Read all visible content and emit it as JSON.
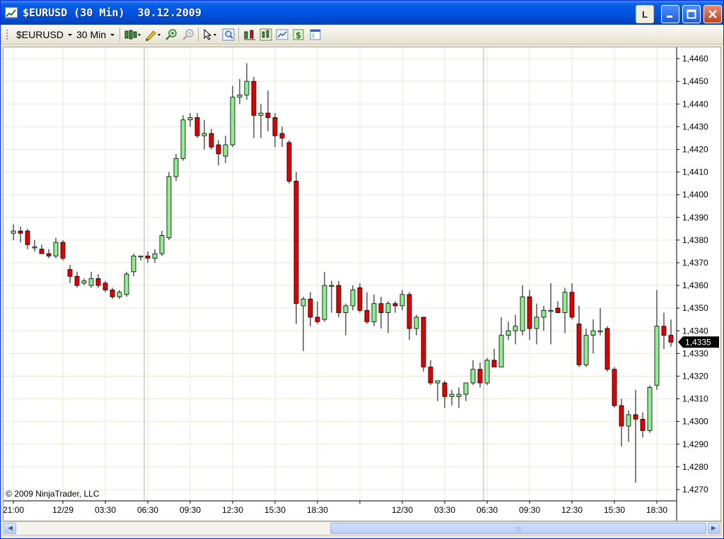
{
  "window": {
    "title": "$EURUSD (30 Min)  30.12.2009",
    "l_button": "L"
  },
  "toolbar": {
    "instrument": "$EURUSD",
    "interval": "30 Min",
    "icons": [
      "chart-style-icon",
      "drawing-pencil-icon",
      "zoom-in-icon",
      "zoom-out-icon",
      "cursor-icon",
      "magnifier-icon",
      "bar-spacing-icon",
      "indicators-icon",
      "strategies-icon",
      "dollar-icon",
      "properties-icon"
    ]
  },
  "chart": {
    "copyright": "© 2009 NinjaTrader, LLC",
    "last_price_label": "1,4335",
    "colors": {
      "up": "#90ee90",
      "down": "#e00000",
      "wick": "#000000",
      "grid": "#ebe8d8",
      "marker_bg": "#000000"
    }
  },
  "chart_data": {
    "type": "candlestick",
    "ylim": [
      1.4265,
      1.4465
    ],
    "y_ticks": [
      "1,4460",
      "1,4450",
      "1,4440",
      "1,4430",
      "1,4420",
      "1,4410",
      "1,4400",
      "1,4390",
      "1,4380",
      "1,4370",
      "1,4360",
      "1,4350",
      "1,4340",
      "1,4330",
      "1,4320",
      "1,4310",
      "1,4300",
      "1,4290",
      "1,4280",
      "1,4270"
    ],
    "x_ticks": [
      {
        "i": 0,
        "label": "21:00"
      },
      {
        "i": 7,
        "label": "12/29"
      },
      {
        "i": 13,
        "label": "03:30"
      },
      {
        "i": 19,
        "label": "06:30"
      },
      {
        "i": 25,
        "label": "09:30"
      },
      {
        "i": 31,
        "label": "12:30"
      },
      {
        "i": 37,
        "label": "15:30"
      },
      {
        "i": 43,
        "label": "18:30"
      },
      {
        "i": 49,
        "label": ""
      },
      {
        "i": 55,
        "label": "12/30"
      },
      {
        "i": 61,
        "label": "03:30"
      },
      {
        "i": 67,
        "label": "06:30"
      },
      {
        "i": 73,
        "label": "09:30"
      },
      {
        "i": 79,
        "label": "12:30"
      },
      {
        "i": 85,
        "label": "15:30"
      },
      {
        "i": 91,
        "label": "18:30"
      }
    ],
    "day_separators": [
      19,
      67
    ],
    "candles": [
      {
        "o": 1.4383,
        "h": 1.4387,
        "l": 1.438,
        "c": 1.4384
      },
      {
        "o": 1.4384,
        "h": 1.4386,
        "l": 1.4379,
        "c": 1.4383
      },
      {
        "o": 1.4384,
        "h": 1.4385,
        "l": 1.4376,
        "c": 1.4378
      },
      {
        "o": 1.4377,
        "h": 1.438,
        "l": 1.4375,
        "c": 1.4377
      },
      {
        "o": 1.4376,
        "h": 1.4378,
        "l": 1.4374,
        "c": 1.4374
      },
      {
        "o": 1.4374,
        "h": 1.4376,
        "l": 1.4372,
        "c": 1.4373
      },
      {
        "o": 1.4373,
        "h": 1.4381,
        "l": 1.4372,
        "c": 1.4379
      },
      {
        "o": 1.4379,
        "h": 1.438,
        "l": 1.4371,
        "c": 1.4372
      },
      {
        "o": 1.4367,
        "h": 1.4369,
        "l": 1.4361,
        "c": 1.4364
      },
      {
        "o": 1.4364,
        "h": 1.4366,
        "l": 1.4359,
        "c": 1.436
      },
      {
        "o": 1.4361,
        "h": 1.4363,
        "l": 1.436,
        "c": 1.4362
      },
      {
        "o": 1.436,
        "h": 1.4366,
        "l": 1.4359,
        "c": 1.4363
      },
      {
        "o": 1.4363,
        "h": 1.4365,
        "l": 1.4359,
        "c": 1.436
      },
      {
        "o": 1.4361,
        "h": 1.4362,
        "l": 1.4357,
        "c": 1.4358
      },
      {
        "o": 1.4358,
        "h": 1.4359,
        "l": 1.4354,
        "c": 1.4355
      },
      {
        "o": 1.4355,
        "h": 1.4358,
        "l": 1.4354,
        "c": 1.4357
      },
      {
        "o": 1.4356,
        "h": 1.4366,
        "l": 1.4355,
        "c": 1.4365
      },
      {
        "o": 1.4366,
        "h": 1.4374,
        "l": 1.4364,
        "c": 1.4373
      },
      {
        "o": 1.4373,
        "h": 1.4373,
        "l": 1.4371,
        "c": 1.4373
      },
      {
        "o": 1.4373,
        "h": 1.4375,
        "l": 1.437,
        "c": 1.4372
      },
      {
        "o": 1.4372,
        "h": 1.4376,
        "l": 1.437,
        "c": 1.4374
      },
      {
        "o": 1.4374,
        "h": 1.4384,
        "l": 1.4373,
        "c": 1.4382
      },
      {
        "o": 1.4381,
        "h": 1.441,
        "l": 1.438,
        "c": 1.4408
      },
      {
        "o": 1.4408,
        "h": 1.4418,
        "l": 1.4406,
        "c": 1.4416
      },
      {
        "o": 1.4416,
        "h": 1.4435,
        "l": 1.4415,
        "c": 1.4433
      },
      {
        "o": 1.4433,
        "h": 1.4436,
        "l": 1.443,
        "c": 1.4434
      },
      {
        "o": 1.4434,
        "h": 1.4436,
        "l": 1.4425,
        "c": 1.4426
      },
      {
        "o": 1.4426,
        "h": 1.4433,
        "l": 1.442,
        "c": 1.4427
      },
      {
        "o": 1.4427,
        "h": 1.4429,
        "l": 1.442,
        "c": 1.4421
      },
      {
        "o": 1.4422,
        "h": 1.4424,
        "l": 1.4413,
        "c": 1.4418
      },
      {
        "o": 1.4417,
        "h": 1.4426,
        "l": 1.4414,
        "c": 1.4422
      },
      {
        "o": 1.4422,
        "h": 1.4448,
        "l": 1.4421,
        "c": 1.4443
      },
      {
        "o": 1.4443,
        "h": 1.4451,
        "l": 1.444,
        "c": 1.4444
      },
      {
        "o": 1.4444,
        "h": 1.4458,
        "l": 1.4442,
        "c": 1.445
      },
      {
        "o": 1.445,
        "h": 1.4452,
        "l": 1.4425,
        "c": 1.4435
      },
      {
        "o": 1.4435,
        "h": 1.444,
        "l": 1.4425,
        "c": 1.4436
      },
      {
        "o": 1.4436,
        "h": 1.4446,
        "l": 1.4428,
        "c": 1.4434
      },
      {
        "o": 1.4434,
        "h": 1.4436,
        "l": 1.4421,
        "c": 1.4426
      },
      {
        "o": 1.4427,
        "h": 1.443,
        "l": 1.4421,
        "c": 1.4425
      },
      {
        "o": 1.4423,
        "h": 1.4424,
        "l": 1.4405,
        "c": 1.4406
      },
      {
        "o": 1.4406,
        "h": 1.441,
        "l": 1.4343,
        "c": 1.4352
      },
      {
        "o": 1.4351,
        "h": 1.4355,
        "l": 1.4331,
        "c": 1.4354
      },
      {
        "o": 1.4354,
        "h": 1.4357,
        "l": 1.4342,
        "c": 1.4346
      },
      {
        "o": 1.4346,
        "h": 1.4353,
        "l": 1.4343,
        "c": 1.4344
      },
      {
        "o": 1.4345,
        "h": 1.4366,
        "l": 1.4344,
        "c": 1.436
      },
      {
        "o": 1.436,
        "h": 1.4362,
        "l": 1.4348,
        "c": 1.436
      },
      {
        "o": 1.436,
        "h": 1.4362,
        "l": 1.4346,
        "c": 1.4348
      },
      {
        "o": 1.4348,
        "h": 1.4352,
        "l": 1.4338,
        "c": 1.4351
      },
      {
        "o": 1.4351,
        "h": 1.436,
        "l": 1.4349,
        "c": 1.4358
      },
      {
        "o": 1.4359,
        "h": 1.4361,
        "l": 1.4348,
        "c": 1.4349
      },
      {
        "o": 1.4349,
        "h": 1.4357,
        "l": 1.4343,
        "c": 1.4344
      },
      {
        "o": 1.4344,
        "h": 1.4356,
        "l": 1.4342,
        "c": 1.4352
      },
      {
        "o": 1.4352,
        "h": 1.4355,
        "l": 1.4341,
        "c": 1.4348
      },
      {
        "o": 1.4348,
        "h": 1.4353,
        "l": 1.4339,
        "c": 1.4352
      },
      {
        "o": 1.4352,
        "h": 1.4353,
        "l": 1.4348,
        "c": 1.4351
      },
      {
        "o": 1.4351,
        "h": 1.4358,
        "l": 1.4349,
        "c": 1.4356
      },
      {
        "o": 1.4356,
        "h": 1.4357,
        "l": 1.4336,
        "c": 1.4341
      },
      {
        "o": 1.4341,
        "h": 1.4347,
        "l": 1.4338,
        "c": 1.4346
      },
      {
        "o": 1.4346,
        "h": 1.4346,
        "l": 1.4322,
        "c": 1.4324
      },
      {
        "o": 1.4324,
        "h": 1.4327,
        "l": 1.4316,
        "c": 1.4317
      },
      {
        "o": 1.4317,
        "h": 1.4318,
        "l": 1.4309,
        "c": 1.4318
      },
      {
        "o": 1.4317,
        "h": 1.4318,
        "l": 1.4306,
        "c": 1.4311
      },
      {
        "o": 1.4311,
        "h": 1.4314,
        "l": 1.4307,
        "c": 1.4312
      },
      {
        "o": 1.4311,
        "h": 1.4315,
        "l": 1.4306,
        "c": 1.4312
      },
      {
        "o": 1.4312,
        "h": 1.4317,
        "l": 1.4309,
        "c": 1.4317
      },
      {
        "o": 1.4317,
        "h": 1.4327,
        "l": 1.4316,
        "c": 1.4323
      },
      {
        "o": 1.4323,
        "h": 1.4326,
        "l": 1.4315,
        "c": 1.4317
      },
      {
        "o": 1.4317,
        "h": 1.4328,
        "l": 1.4316,
        "c": 1.4327
      },
      {
        "o": 1.4327,
        "h": 1.4332,
        "l": 1.4324,
        "c": 1.4324
      },
      {
        "o": 1.4324,
        "h": 1.4346,
        "l": 1.4324,
        "c": 1.4338
      },
      {
        "o": 1.4338,
        "h": 1.4344,
        "l": 1.4336,
        "c": 1.434
      },
      {
        "o": 1.434,
        "h": 1.4347,
        "l": 1.4334,
        "c": 1.4342
      },
      {
        "o": 1.434,
        "h": 1.436,
        "l": 1.4338,
        "c": 1.4355
      },
      {
        "o": 1.4355,
        "h": 1.4358,
        "l": 1.4336,
        "c": 1.4341
      },
      {
        "o": 1.4341,
        "h": 1.4352,
        "l": 1.4334,
        "c": 1.4346
      },
      {
        "o": 1.4346,
        "h": 1.4351,
        "l": 1.434,
        "c": 1.4349
      },
      {
        "o": 1.4349,
        "h": 1.4361,
        "l": 1.4334,
        "c": 1.4349
      },
      {
        "o": 1.435,
        "h": 1.4353,
        "l": 1.4348,
        "c": 1.4348
      },
      {
        "o": 1.4348,
        "h": 1.4359,
        "l": 1.4339,
        "c": 1.4357
      },
      {
        "o": 1.4357,
        "h": 1.4361,
        "l": 1.4345,
        "c": 1.4346
      },
      {
        "o": 1.4343,
        "h": 1.4351,
        "l": 1.4324,
        "c": 1.4325
      },
      {
        "o": 1.4325,
        "h": 1.4341,
        "l": 1.4324,
        "c": 1.4338
      },
      {
        "o": 1.4338,
        "h": 1.4345,
        "l": 1.433,
        "c": 1.434
      },
      {
        "o": 1.434,
        "h": 1.435,
        "l": 1.4338,
        "c": 1.434
      },
      {
        "o": 1.4341,
        "h": 1.4342,
        "l": 1.4322,
        "c": 1.4323
      },
      {
        "o": 1.4323,
        "h": 1.4324,
        "l": 1.4306,
        "c": 1.4307
      },
      {
        "o": 1.4307,
        "h": 1.431,
        "l": 1.4289,
        "c": 1.4298
      },
      {
        "o": 1.4298,
        "h": 1.4305,
        "l": 1.4291,
        "c": 1.4303
      },
      {
        "o": 1.4303,
        "h": 1.4314,
        "l": 1.4273,
        "c": 1.4301
      },
      {
        "o": 1.4301,
        "h": 1.4304,
        "l": 1.4293,
        "c": 1.4296
      },
      {
        "o": 1.4296,
        "h": 1.4316,
        "l": 1.4295,
        "c": 1.4315
      },
      {
        "o": 1.4316,
        "h": 1.4358,
        "l": 1.4314,
        "c": 1.4342
      },
      {
        "o": 1.4342,
        "h": 1.4348,
        "l": 1.4332,
        "c": 1.4338
      },
      {
        "o": 1.4338,
        "h": 1.4345,
        "l": 1.4333,
        "c": 1.4335
      }
    ]
  }
}
